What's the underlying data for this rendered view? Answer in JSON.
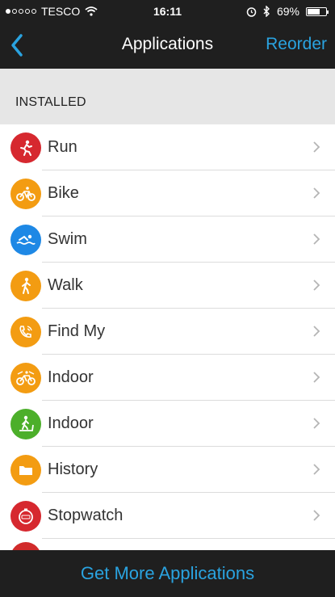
{
  "status_bar": {
    "carrier": "TESCO",
    "time": "16:11",
    "battery_percent": "69%",
    "battery_level": 0.69,
    "signal_bars_filled": 1,
    "signal_bars_total": 5
  },
  "nav": {
    "title": "Applications",
    "reorder_label": "Reorder",
    "back_icon": "chevron-left-icon"
  },
  "section": {
    "label": "INSTALLED"
  },
  "apps": [
    {
      "label": "Run",
      "icon": "run-icon",
      "color": "#d6282f"
    },
    {
      "label": "Bike",
      "icon": "bike-icon",
      "color": "#f39c12"
    },
    {
      "label": "Swim",
      "icon": "swim-icon",
      "color": "#1e88e5"
    },
    {
      "label": "Walk",
      "icon": "walk-icon",
      "color": "#f39c12"
    },
    {
      "label": "Find My",
      "icon": "phone-icon",
      "color": "#f39c12"
    },
    {
      "label": "Indoor",
      "icon": "indoor-bike-icon",
      "color": "#f39c12"
    },
    {
      "label": "Indoor",
      "icon": "treadmill-icon",
      "color": "#4caf2a"
    },
    {
      "label": "History",
      "icon": "history-icon",
      "color": "#f39c12"
    },
    {
      "label": "Stopwatch",
      "icon": "stopwatch-icon",
      "color": "#d6282f"
    }
  ],
  "footer": {
    "button_label": "Get More Applications"
  },
  "colors": {
    "accent": "#2aa3e0",
    "bar_background": "#1f1f1f",
    "section_background": "#e6e6e6"
  }
}
